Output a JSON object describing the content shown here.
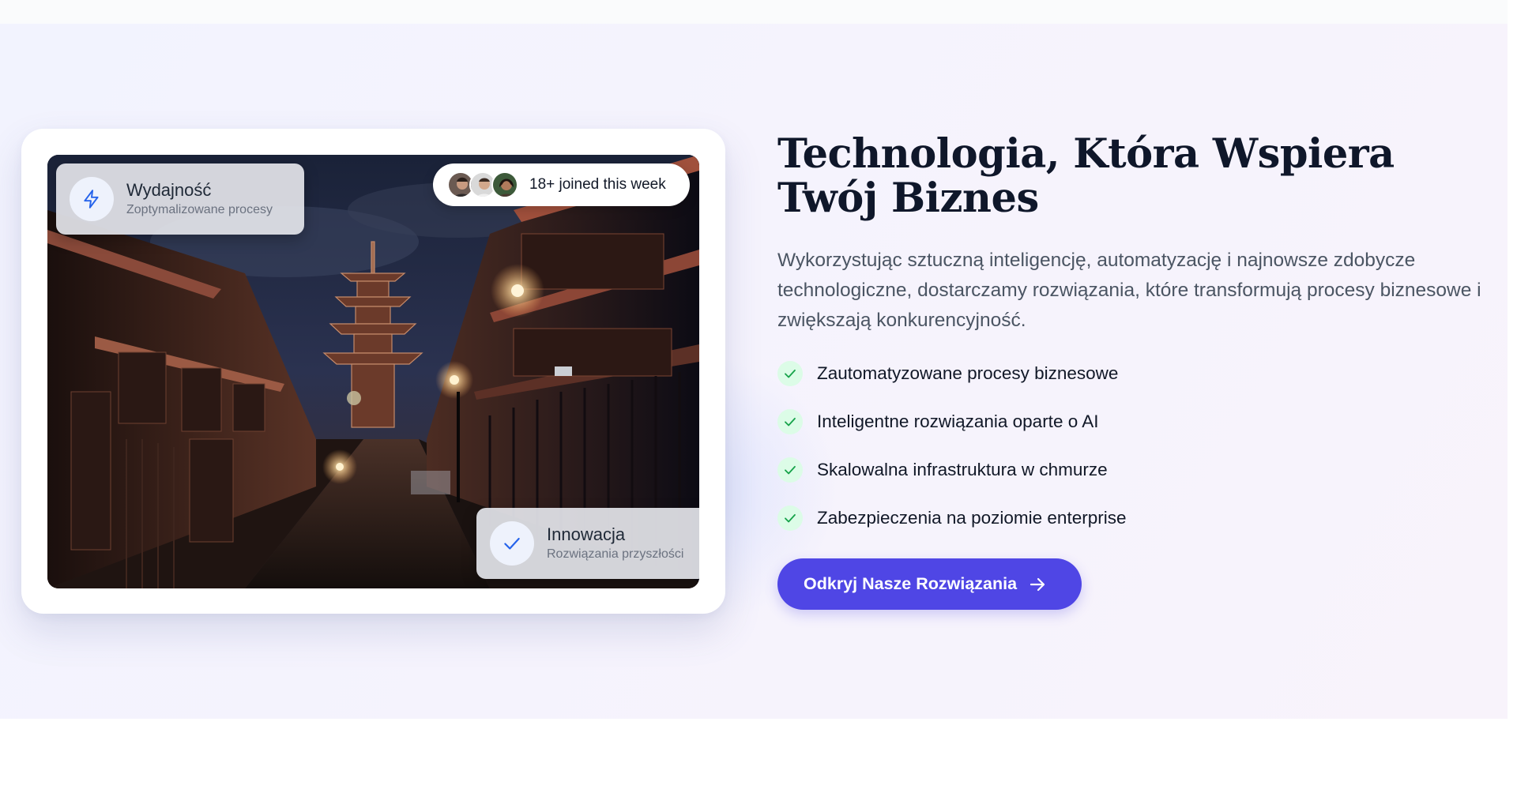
{
  "page": {
    "background": "#ffffff",
    "section_gradient": [
      "#f2f3fe",
      "#f8f3fb"
    ]
  },
  "image_card": {
    "stat_top": {
      "icon": "lightning-icon",
      "title": "Wydajność",
      "subtitle": "Zoptymalizowane procesy"
    },
    "joined_pill": {
      "avatars": [
        "avatar-man-1",
        "avatar-man-2",
        "avatar-woman-1"
      ],
      "text": "18+ joined this week"
    },
    "stat_bottom": {
      "icon": "check-icon",
      "title": "Innowacja",
      "subtitle": "Rozwiązania przyszłości"
    }
  },
  "content": {
    "heading": "Technologia, Która Wspiera Twój Biznes",
    "description": "Wykorzystując sztuczną inteligencję, automatyzację i najnowsze zdobycze technologiczne, dostarczamy rozwiązania, które transformują procesy biznesowe i zwiększają konkurencyjność.",
    "features": [
      {
        "label": "Zautomatyzowane procesy biznesowe",
        "icon": "check-icon"
      },
      {
        "label": "Inteligentne rozwiązania oparte o AI",
        "icon": "check-icon"
      },
      {
        "label": "Skalowalna infrastruktura w chmurze",
        "icon": "check-icon"
      },
      {
        "label": "Zabezpieczenia na poziomie enterprise",
        "icon": "check-icon"
      }
    ],
    "cta": {
      "label": "Odkryj Nasze Rozwiązania",
      "icon": "arrow-right-icon"
    }
  },
  "colors": {
    "accent": "#4f46e5",
    "check_bg": "#dcfce7",
    "check": "#16a34a",
    "icon_blue": "#2563eb",
    "heading": "#0f172a",
    "body_text": "#4b5563"
  }
}
